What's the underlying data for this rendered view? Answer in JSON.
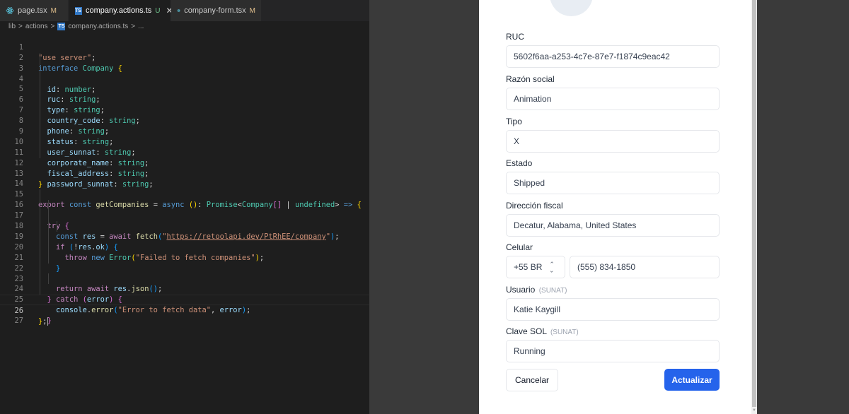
{
  "editor": {
    "tabs": [
      {
        "name": "page.tsx",
        "badge": "M",
        "icon": "react-icon"
      },
      {
        "name": "company.actions.ts",
        "badge": "U",
        "icon": "ts-icon"
      },
      {
        "name": "company-form.tsx",
        "badge": "M",
        "icon": "react-icon"
      }
    ],
    "breadcrumb": [
      "lib",
      "actions",
      "company.actions.ts",
      "..."
    ],
    "line_numbers": [
      "1",
      "2",
      "3",
      "4",
      "5",
      "6",
      "7",
      "8",
      "9",
      "10",
      "11",
      "12",
      "13",
      "14",
      "15",
      "16",
      "17",
      "18",
      "19",
      "20",
      "21",
      "22",
      "23",
      "24",
      "25",
      "26",
      "27"
    ],
    "code": {
      "l1": "\"use server\"",
      "l2_kw": "interface",
      "l2_ty": "Company",
      "fields": [
        "id",
        "ruc",
        "type",
        "country_code",
        "phone",
        "status",
        "user_sunnat",
        "corporate_name",
        "fiscal_address",
        "password_sunnat"
      ],
      "types": [
        "number",
        "string",
        "string",
        "string",
        "string",
        "string",
        "string",
        "string",
        "string",
        "string"
      ],
      "l15_export": "export",
      "l15_const": "const",
      "l15_fn": "getCompanies",
      "l15_async": "async",
      "l15_promise": "Promise",
      "l15_company": "Company",
      "l15_undefined": "undefined",
      "l16_try": "try",
      "l17_const": "const",
      "l17_res": "res",
      "l17_await": "await",
      "l17_fetch": "fetch",
      "l17_url": "https://retoolapi.dev/PtRhEE/company",
      "l18_if": "if",
      "l18_res": "res",
      "l18_ok": "ok",
      "l19_throw": "throw",
      "l19_new": "new",
      "l19_error": "Error",
      "l19_msg": "\"Failed to fetch companies\"",
      "l22_return": "return",
      "l22_await": "await",
      "l22_res": "res",
      "l22_json": "json",
      "l23_catch": "catch",
      "l23_error": "error",
      "l24_console": "console",
      "l24_fn": "error",
      "l24_msg": "\"Error to fetch data\"",
      "l24_error": "error"
    }
  },
  "form": {
    "ruc": {
      "label": "RUC",
      "value": "5602f6aa-a253-4c7e-87e7-f1874c9eac42"
    },
    "razon_social": {
      "label": "Razón social",
      "value": "Animation"
    },
    "tipo": {
      "label": "Tipo",
      "value": "X"
    },
    "estado": {
      "label": "Estado",
      "value": "Shipped"
    },
    "direccion": {
      "label": "Dirección fiscal",
      "value": "Decatur, Alabama, United States"
    },
    "celular": {
      "label": "Celular",
      "country": "+55 BR",
      "value": "(555) 834-1850"
    },
    "usuario": {
      "label": "Usuario",
      "sub": "(SUNAT)",
      "value": "Katie Kaygill"
    },
    "clave": {
      "label": "Clave SOL",
      "sub": "(SUNAT)",
      "value": "Running"
    },
    "cancel_label": "Cancelar",
    "update_label": "Actualizar"
  },
  "colors": {
    "accent": "#2563eb",
    "editor_bg": "#1e1e1e"
  }
}
